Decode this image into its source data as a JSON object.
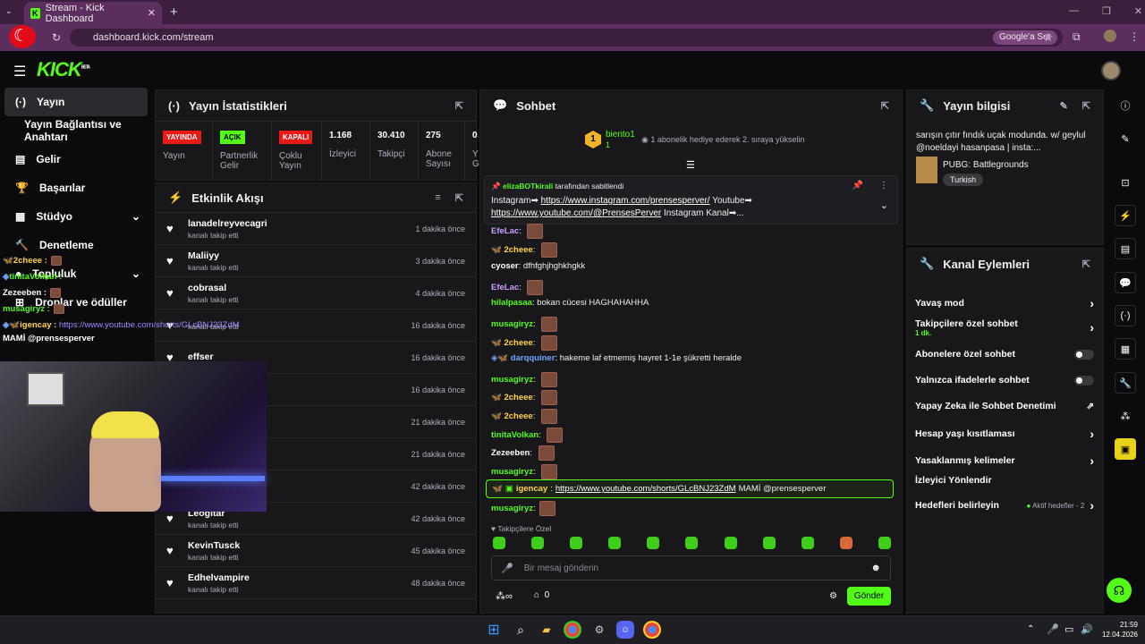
{
  "browser": {
    "tab_title": "Stream - Kick Dashboard",
    "url": "dashboard.kick.com/stream",
    "google_button": "Google'a Sor"
  },
  "app": {
    "logo": "KICK",
    "logo_sup": "BETA"
  },
  "sidebar": {
    "items": [
      {
        "label": "Yayın",
        "icon": "broadcast-icon"
      },
      {
        "label": "Yayın Bağlantısı ve Anahtarı",
        "icon": ""
      },
      {
        "label": "Gelir",
        "icon": "chart-icon"
      },
      {
        "label": "Başarılar",
        "icon": "trophy-icon"
      },
      {
        "label": "Stüdyo",
        "icon": "studio-icon"
      },
      {
        "label": "Denetleme",
        "icon": "hammer-icon"
      },
      {
        "label": "Topluluk",
        "icon": "community-icon"
      },
      {
        "label": "Droplar ve ödüller",
        "icon": "gift-icon"
      }
    ]
  },
  "stats": {
    "title": "Yayın İstatistikleri",
    "items": [
      {
        "badge": "YAYINDA",
        "label": "Yayın",
        "color": "#e91916"
      },
      {
        "badge": "AÇIK",
        "label": "Partnerlik Gelir",
        "color": "#53fc18"
      },
      {
        "badge": "KAPALI",
        "label": "Çoklu Yayın",
        "color": "#e91916"
      },
      {
        "value": "1.168",
        "label": "İzleyici"
      },
      {
        "value": "30.410",
        "label": "Takipçi"
      },
      {
        "value": "275",
        "label": "Abone Sayısı"
      },
      {
        "value": "0",
        "label": "Y G"
      }
    ]
  },
  "activity": {
    "title": "Etkinlik Akışı",
    "events": [
      {
        "name": "lanadelreyvecagri",
        "sub": "kanalı takip etti",
        "time": "1 dakika önce"
      },
      {
        "name": "Maliiyy",
        "sub": "kanalı takip etti",
        "time": "3 dakika önce"
      },
      {
        "name": "cobrasal",
        "sub": "kanalı takip etti",
        "time": "4 dakika önce"
      },
      {
        "name": "",
        "sub": "kanalı takip etti",
        "time": "16 dakika önce"
      },
      {
        "name": "effser",
        "sub": "",
        "time": "16 dakika önce"
      },
      {
        "name": "",
        "sub": "",
        "time": "16 dakika önce"
      },
      {
        "name": "",
        "sub": "",
        "time": "21 dakika önce"
      },
      {
        "name": "",
        "sub": "",
        "time": "21 dakika önce"
      },
      {
        "name": "e oldu!",
        "sub": "",
        "time": "42 dakika önce"
      },
      {
        "name": "Leogitar",
        "sub": "kanalı takip etti",
        "time": "42 dakika önce"
      },
      {
        "name": "KevinTusck",
        "sub": "kanalı takip etti",
        "time": "45 dakika önce"
      },
      {
        "name": "Edhelvampire",
        "sub": "kanalı takip etti",
        "time": "48 dakika önce"
      }
    ]
  },
  "chat": {
    "title": "Sohbet",
    "top_gifter": {
      "name": "biento1",
      "rank": "1",
      "count": "1",
      "text": "1 abonelik hediye ederek 2. sıraya yükselin"
    },
    "pinned": {
      "by_user": "elizaBOTkirali",
      "by_text": "tarafından sabitlendi",
      "line1_prefix": "Instagram➡",
      "line1_link": "https://www.instagram.com/prensesperver/",
      "line1_suffix": "Youtube➡",
      "line2_link": "https://www.youtube.com/@PrensesPerver",
      "line2_suffix": "Instagram Kanal➡..."
    },
    "messages": [
      {
        "user": "EfeLac",
        "color": "#c8a0ff",
        "text": "",
        "emote": true
      },
      {
        "user": "2cheee",
        "color": "#ffd24d",
        "text": "",
        "emote": true
      },
      {
        "user": "cyoser",
        "color": "#ffffff",
        "text": "dfhfghjhghkhgkk",
        "emote": false
      },
      {
        "user": "EfeLac",
        "color": "#c8a0ff",
        "text": "",
        "emote": true
      },
      {
        "user": "hilalpasaa",
        "color": "#53fc18",
        "text": "bokan cücesi HAGHAHAHHA",
        "emote": false
      },
      {
        "user": "musagiryz",
        "color": "#53fc18",
        "text": "",
        "emote": true
      },
      {
        "user": "2cheee",
        "color": "#ffd24d",
        "text": "",
        "emote": true
      },
      {
        "user": "darqquiner",
        "color": "#6fa8ff",
        "text": "hakeme laf etmemiş hayret 1-1e şükretti heralde",
        "emote": false
      },
      {
        "user": "musagiryz",
        "color": "#53fc18",
        "text": "",
        "emote": true
      },
      {
        "user": "2cheee",
        "color": "#ffd24d",
        "text": "",
        "emote": true
      },
      {
        "user": "2cheee",
        "color": "#ffd24d",
        "text": "",
        "emote": true
      },
      {
        "user": "tinitaVolkan",
        "color": "#53fc18",
        "text": "",
        "emote": true
      },
      {
        "user": "Zezeeben",
        "color": "#ffffff",
        "text": "",
        "emote": true
      },
      {
        "user": "musagiryz",
        "color": "#53fc18",
        "text": "",
        "emote": true
      }
    ],
    "highlight": {
      "user": "igencay",
      "link": "https://www.youtube.com/shorts/GLcBNJ23ZdM",
      "text": "MAMİ @prensesperver"
    },
    "last": {
      "user": "musagiryz"
    },
    "followers_only": "Takipçilere Özel",
    "input_placeholder": "Bir mesaj gönderin",
    "points": "0",
    "send_button": "Gönder"
  },
  "stream_info": {
    "title": "Yayın bilgisi",
    "description": "sarışın çıtır fındık uçak modunda. w/ geylul @noeldayi hasanpasa | insta:...",
    "category": "PUBG: Battlegrounds",
    "language": "Turkish"
  },
  "channel_actions": {
    "title": "Kanal Eylemleri",
    "items": [
      {
        "label": "Yavaş mod",
        "type": "arrow"
      },
      {
        "label": "Takipçilere özel sohbet",
        "sub": "1 dk.",
        "type": "arrow"
      },
      {
        "label": "Abonelere özel sohbet",
        "type": "toggle"
      },
      {
        "label": "Yalnızca ifadelerle sohbet",
        "type": "toggle"
      },
      {
        "label": "Yapay Zeka ile Sohbet Denetimi",
        "type": "external"
      },
      {
        "label": "Hesap yaşı kısıtlaması",
        "type": "arrow"
      },
      {
        "label": "Yasaklanmış kelimeler",
        "type": "arrow"
      },
      {
        "label": "İzleyici Yönlendir",
        "type": "none"
      },
      {
        "label": "Hedefleri belirleyin",
        "type": "arrow",
        "extra": "Aktif hedefler - 2"
      }
    ]
  },
  "overlay": {
    "lines": [
      {
        "user": "2cheee :",
        "color": "#ffd24d"
      },
      {
        "user": "tinitaVolkan :",
        "color": "#53fc18"
      },
      {
        "user": "Zezeeben :",
        "color": "#ffffff"
      },
      {
        "user": "musagiryz :",
        "color": "#53fc18"
      },
      {
        "user": "igencay :",
        "color": "#ffd24d"
      }
    ],
    "link": "https://www.youtube.com/shorts/GLcBNJ23ZdM",
    "tail": "MAMİ @prensesperver"
  },
  "taskbar": {
    "time": "21:59",
    "date": "12.04.2026"
  },
  "colors": {
    "accent": "#53fc18",
    "panel": "#18181b"
  }
}
